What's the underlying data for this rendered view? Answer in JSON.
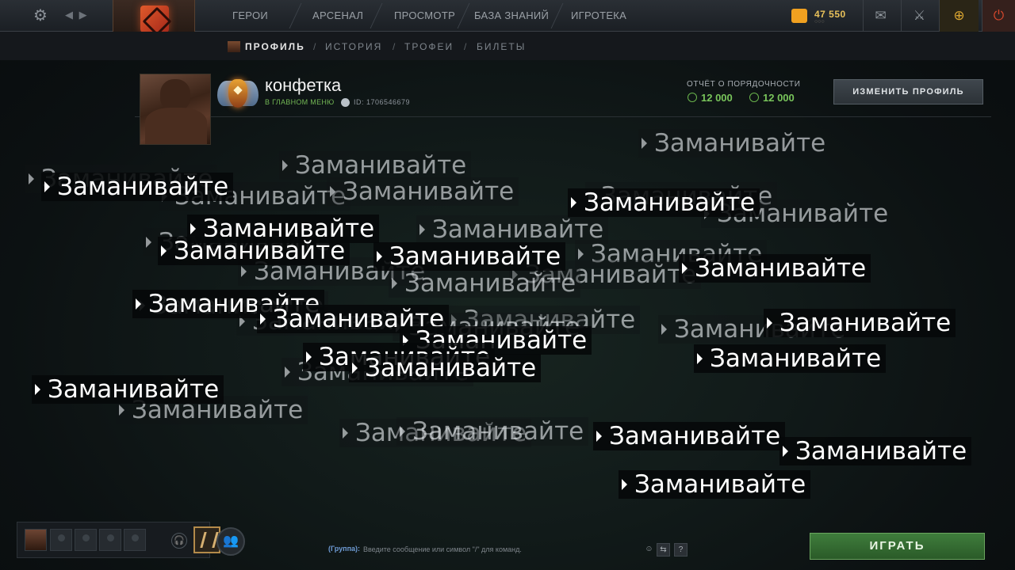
{
  "topbar": {
    "nav": [
      "ГЕРОИ",
      "АРСЕНАЛ",
      "ПРОСМОТР",
      "БАЗА ЗНАНИЙ",
      "ИГРОТЕКА"
    ],
    "gold": "47 550",
    "gold_sub": "○○○",
    "icons": {
      "settings": "gear-icon",
      "mail": "mail-icon",
      "armory": "armory-icon",
      "plus": "plus-icon",
      "power": "power-icon"
    }
  },
  "subnav": {
    "items": [
      "ПРОФИЛЬ",
      "ИСТОРИЯ",
      "ТРОФЕИ",
      "БИЛЕТЫ"
    ],
    "separator": "/"
  },
  "profile": {
    "name": "конфетка",
    "status": "В ГЛАВНОМ МЕНЮ",
    "id_label": "ID: 1706546679",
    "conduct_label": "ОТЧЁТ О ПОРЯДОЧНОСТИ",
    "conduct_value_1": "12 000",
    "conduct_value_2": "12 000",
    "edit_button": "ИЗМЕНИТЬ ПРОФИЛЬ"
  },
  "spam": {
    "text": "Заманивайте"
  },
  "bottom": {
    "chat_prefix": "(Группа):",
    "chat_placeholder": "Введите сообщение или символ \"/\" для команд.",
    "help": "?",
    "play_button": "ИГРАТЬ"
  },
  "colors": {
    "accent_green": "#79c55b",
    "play_green": "#3f7d3c",
    "gold": "#e8c15a"
  }
}
